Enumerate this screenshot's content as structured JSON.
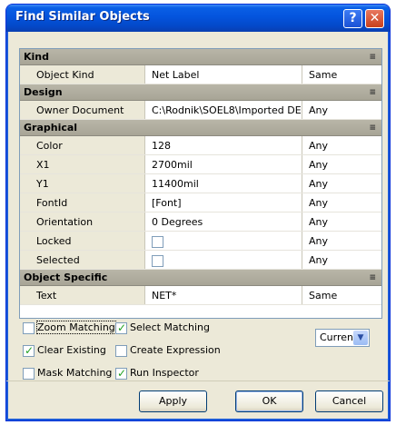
{
  "window": {
    "title": "Find Similar Objects",
    "help_label": "?",
    "close_label": "✕"
  },
  "grid": {
    "sections": [
      {
        "name": "Kind",
        "rows": [
          {
            "label": "Object Kind",
            "value": "Net Label",
            "match": "Same"
          }
        ]
      },
      {
        "name": "Design",
        "rows": [
          {
            "label": "Owner Document",
            "value": "C:\\Rodnik\\SOEL8\\Imported DEM",
            "match": "Any"
          }
        ]
      },
      {
        "name": "Graphical",
        "rows": [
          {
            "label": "Color",
            "value": "128",
            "match": "Any"
          },
          {
            "label": "X1",
            "value": "2700mil",
            "match": "Any"
          },
          {
            "label": "Y1",
            "value": "11400mil",
            "match": "Any"
          },
          {
            "label": "FontId",
            "value": "[Font]",
            "match": "Any"
          },
          {
            "label": "Orientation",
            "value": "0 Degrees",
            "match": "Any"
          },
          {
            "label": "Locked",
            "value": "",
            "checkbox": false,
            "match": "Any"
          },
          {
            "label": "Selected",
            "value": "",
            "checkbox": false,
            "match": "Any"
          }
        ]
      },
      {
        "name": "Object Specific",
        "rows": [
          {
            "label": "Text",
            "value": "NET*",
            "match": "Same"
          }
        ]
      }
    ]
  },
  "options": {
    "zoom_matching": {
      "label": "Zoom Matching",
      "checked": false
    },
    "select_matching": {
      "label": "Select Matching",
      "checked": true
    },
    "clear_existing": {
      "label": "Clear Existing",
      "checked": true
    },
    "create_expression": {
      "label": "Create Expression",
      "checked": false
    },
    "mask_matching": {
      "label": "Mask Matching",
      "checked": false
    },
    "run_inspector": {
      "label": "Run Inspector",
      "checked": true
    }
  },
  "scope_select": {
    "value": "Current"
  },
  "buttons": {
    "apply": "Apply",
    "ok": "OK",
    "cancel": "Cancel"
  }
}
